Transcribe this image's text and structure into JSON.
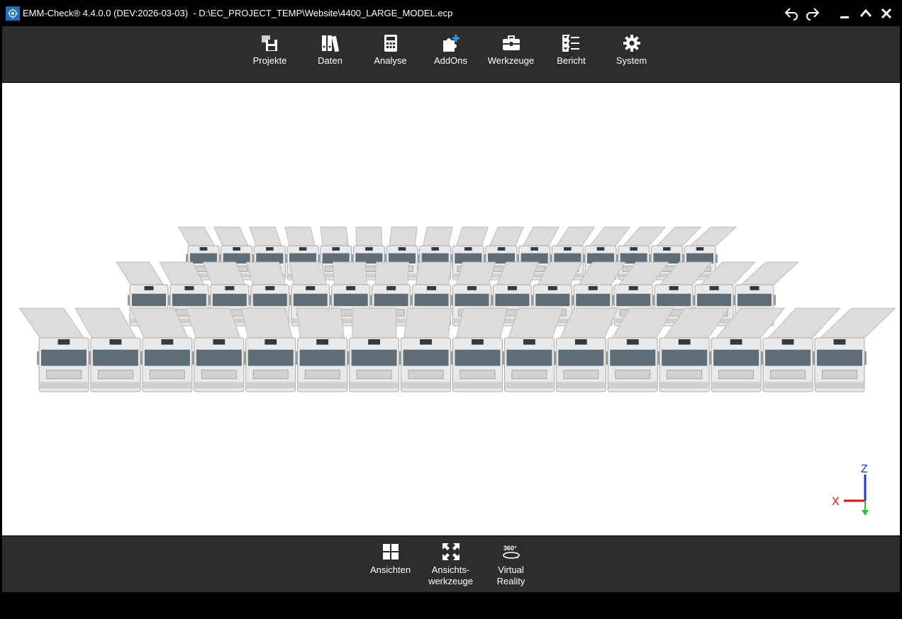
{
  "window": {
    "title": "EMM-Check® 4.4.0.0 (DEV:2026-03-03)  - D:\\EC_PROJECT_TEMP\\Website\\4400_LARGE_MODEL.ecp",
    "icons": [
      "app-logo",
      "undo-icon",
      "redo-icon",
      "minimize-icon",
      "maximize-icon",
      "close-icon"
    ]
  },
  "toolbar": {
    "items": [
      {
        "label": "Projekte",
        "icon": "projects-icon"
      },
      {
        "label": "Daten",
        "icon": "binders-icon"
      },
      {
        "label": "Analyse",
        "icon": "calculator-icon"
      },
      {
        "label": "AddOns",
        "icon": "puzzle-plus-icon"
      },
      {
        "label": "Werkzeuge",
        "icon": "toolbox-icon"
      },
      {
        "label": "Bericht",
        "icon": "checklist-icon"
      },
      {
        "label": "System",
        "icon": "gear-icon"
      }
    ]
  },
  "viewport": {
    "content": "3D model: 3 rows of tipper trucks",
    "rows": [
      16,
      16,
      16
    ],
    "axis": {
      "x_label": "X",
      "z_label": "Z",
      "x_color": "#e01010",
      "z_color": "#1a3ad0",
      "y_color": "#2ec22e"
    }
  },
  "bottombar": {
    "items": [
      {
        "label": "Ansichten",
        "icon": "grid-views-icon"
      },
      {
        "label": "Ansichts-\nwerkzeuge",
        "icon": "expand-icon"
      },
      {
        "label": "Virtual\nReality",
        "icon": "vr-360-icon"
      }
    ]
  },
  "colors": {
    "toolbar_bg": "#2d2d2d",
    "titlebar_bg": "#000000",
    "viewport_bg": "#ffffff"
  }
}
